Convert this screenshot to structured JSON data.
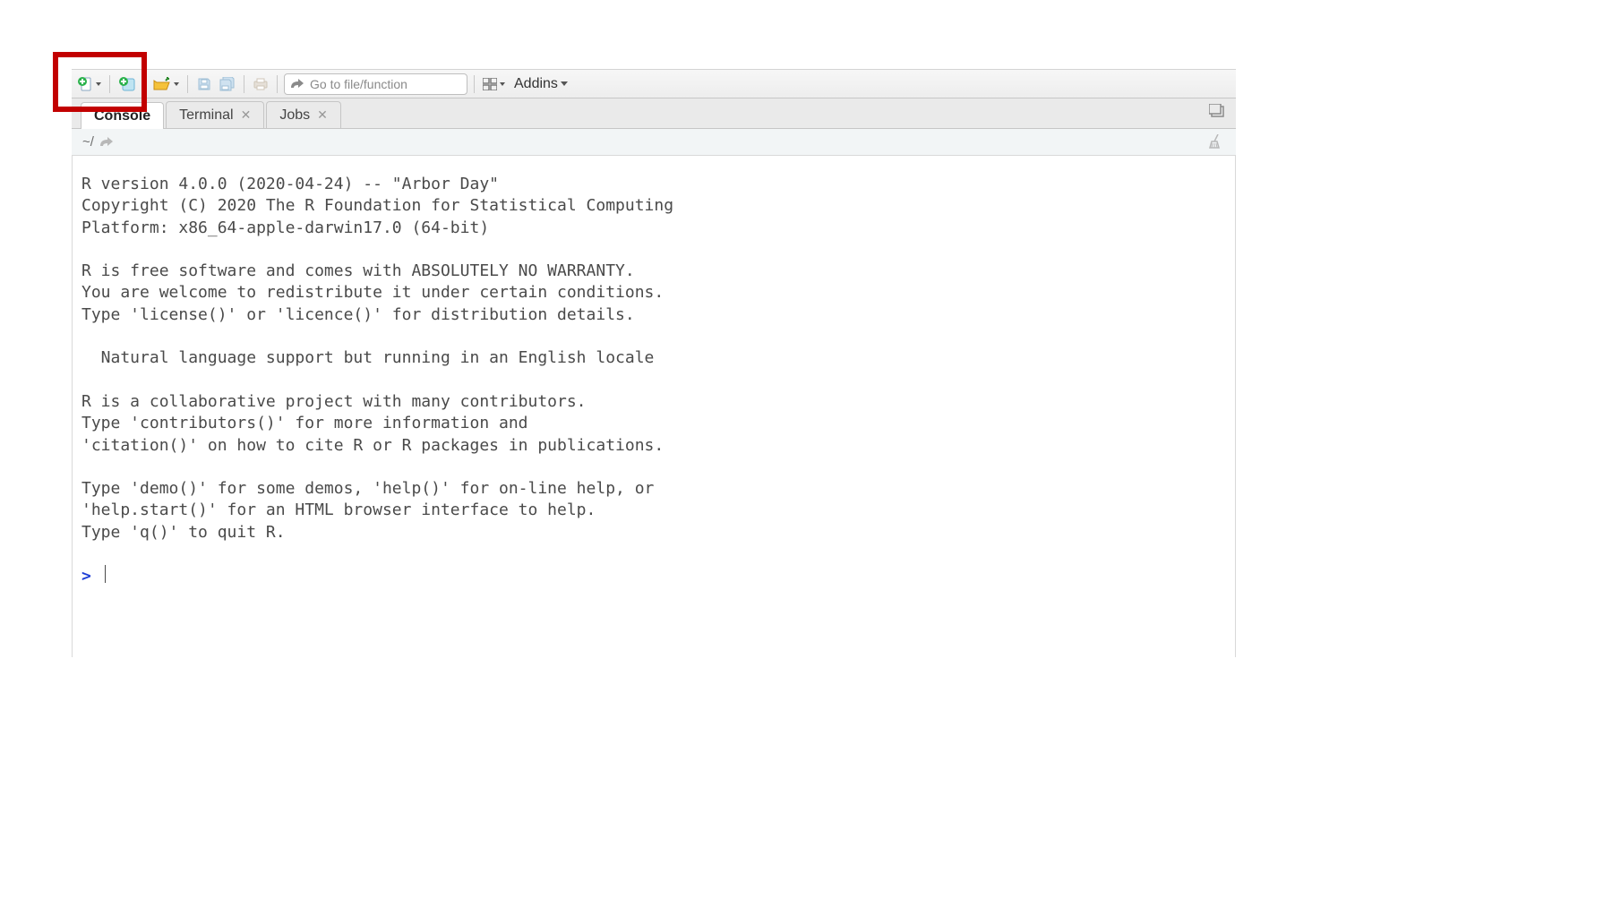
{
  "toolbar": {
    "goto_placeholder": "Go to file/function",
    "addins_label": "Addins"
  },
  "tabs": [
    {
      "label": "Console",
      "closable": false,
      "active": true
    },
    {
      "label": "Terminal",
      "closable": true,
      "active": false
    },
    {
      "label": "Jobs",
      "closable": true,
      "active": false
    }
  ],
  "pathbar": {
    "cwd": "~/"
  },
  "console": {
    "output": "R version 4.0.0 (2020-04-24) -- \"Arbor Day\"\nCopyright (C) 2020 The R Foundation for Statistical Computing\nPlatform: x86_64-apple-darwin17.0 (64-bit)\n\nR is free software and comes with ABSOLUTELY NO WARRANTY.\nYou are welcome to redistribute it under certain conditions.\nType 'license()' or 'licence()' for distribution details.\n\n  Natural language support but running in an English locale\n\nR is a collaborative project with many contributors.\nType 'contributors()' for more information and\n'citation()' on how to cite R or R packages in publications.\n\nType 'demo()' for some demos, 'help()' for on-line help, or\n'help.start()' for an HTML browser interface to help.\nType 'q()' to quit R.\n",
    "prompt": ">"
  },
  "highlight": {
    "description": "Red rectangle annotation around the New File button"
  }
}
